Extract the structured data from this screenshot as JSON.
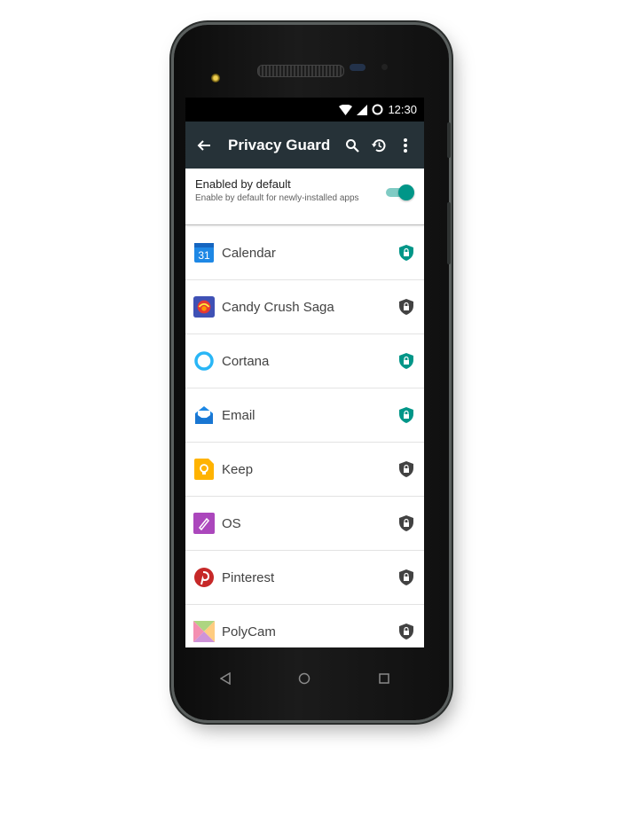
{
  "status_bar": {
    "time": "12:30"
  },
  "toolbar": {
    "title": "Privacy Guard",
    "back_icon": "arrow-left-icon",
    "icons": [
      "search-icon",
      "history-icon",
      "more-vert-icon"
    ]
  },
  "default_setting": {
    "title": "Enabled by default",
    "subtitle": "Enable by default for newly-installed apps",
    "enabled": true
  },
  "apps": [
    {
      "name": "Calendar",
      "icon": "calendar-app-icon",
      "calendar_day": "31",
      "guarded": true
    },
    {
      "name": "Candy Crush Saga",
      "icon": "candy-crush-app-icon",
      "guarded": false
    },
    {
      "name": "Cortana",
      "icon": "cortana-app-icon",
      "guarded": true
    },
    {
      "name": "Email",
      "icon": "email-app-icon",
      "guarded": true
    },
    {
      "name": "Keep",
      "icon": "keep-app-icon",
      "guarded": false
    },
    {
      "name": "OS",
      "icon": "os-app-icon",
      "guarded": false
    },
    {
      "name": "Pinterest",
      "icon": "pinterest-app-icon",
      "guarded": false
    },
    {
      "name": "PolyCam",
      "icon": "polycam-app-icon",
      "guarded": false
    }
  ],
  "colors": {
    "accent": "#009688",
    "toolbar": "#263238",
    "shield_off": "#424242"
  }
}
